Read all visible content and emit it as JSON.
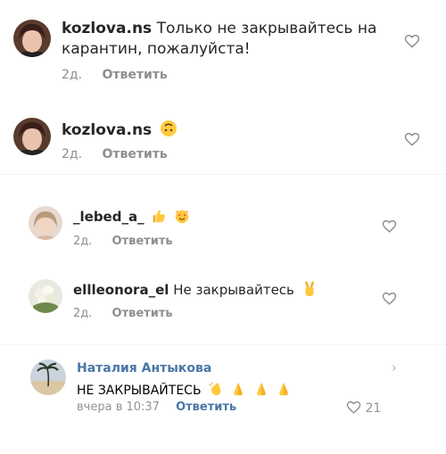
{
  "comments": [
    {
      "username": "kozlova.ns",
      "text_line1": "Только не закрывайтесь на",
      "text_line2": "карантин, пожалуйста!",
      "time": "2д.",
      "reply_label": "Ответить",
      "emoji": []
    },
    {
      "username": "kozlova.ns",
      "text_line1": "",
      "time": "2д.",
      "reply_label": "Ответить",
      "emoji": [
        "upside-down-face"
      ]
    },
    {
      "username": "_lebed_a_",
      "text_line1": "",
      "time": "2д.",
      "reply_label": "Ответить",
      "emoji": [
        "thumbs-up",
        "heart-eyes-cat"
      ]
    },
    {
      "username": "ellleonora_el",
      "text_line1": "Не закрывайтесь",
      "time": "2д.",
      "reply_label": "Ответить",
      "emoji": [
        "victory-hand"
      ]
    }
  ],
  "vk_comment": {
    "username": "Наталия Антыкова",
    "text": "НЕ ЗАКРЫВАЙТЕСЬ",
    "emoji": [
      "clapping-hands",
      "folded-hands",
      "folded-hands",
      "folded-hands"
    ],
    "time": "вчера в 10:37",
    "reply_label": "Ответить",
    "likes": "21"
  },
  "colors": {
    "username": "#262626",
    "meta_gray": "#8e8e8e",
    "vk_blue": "#4a76a8"
  }
}
